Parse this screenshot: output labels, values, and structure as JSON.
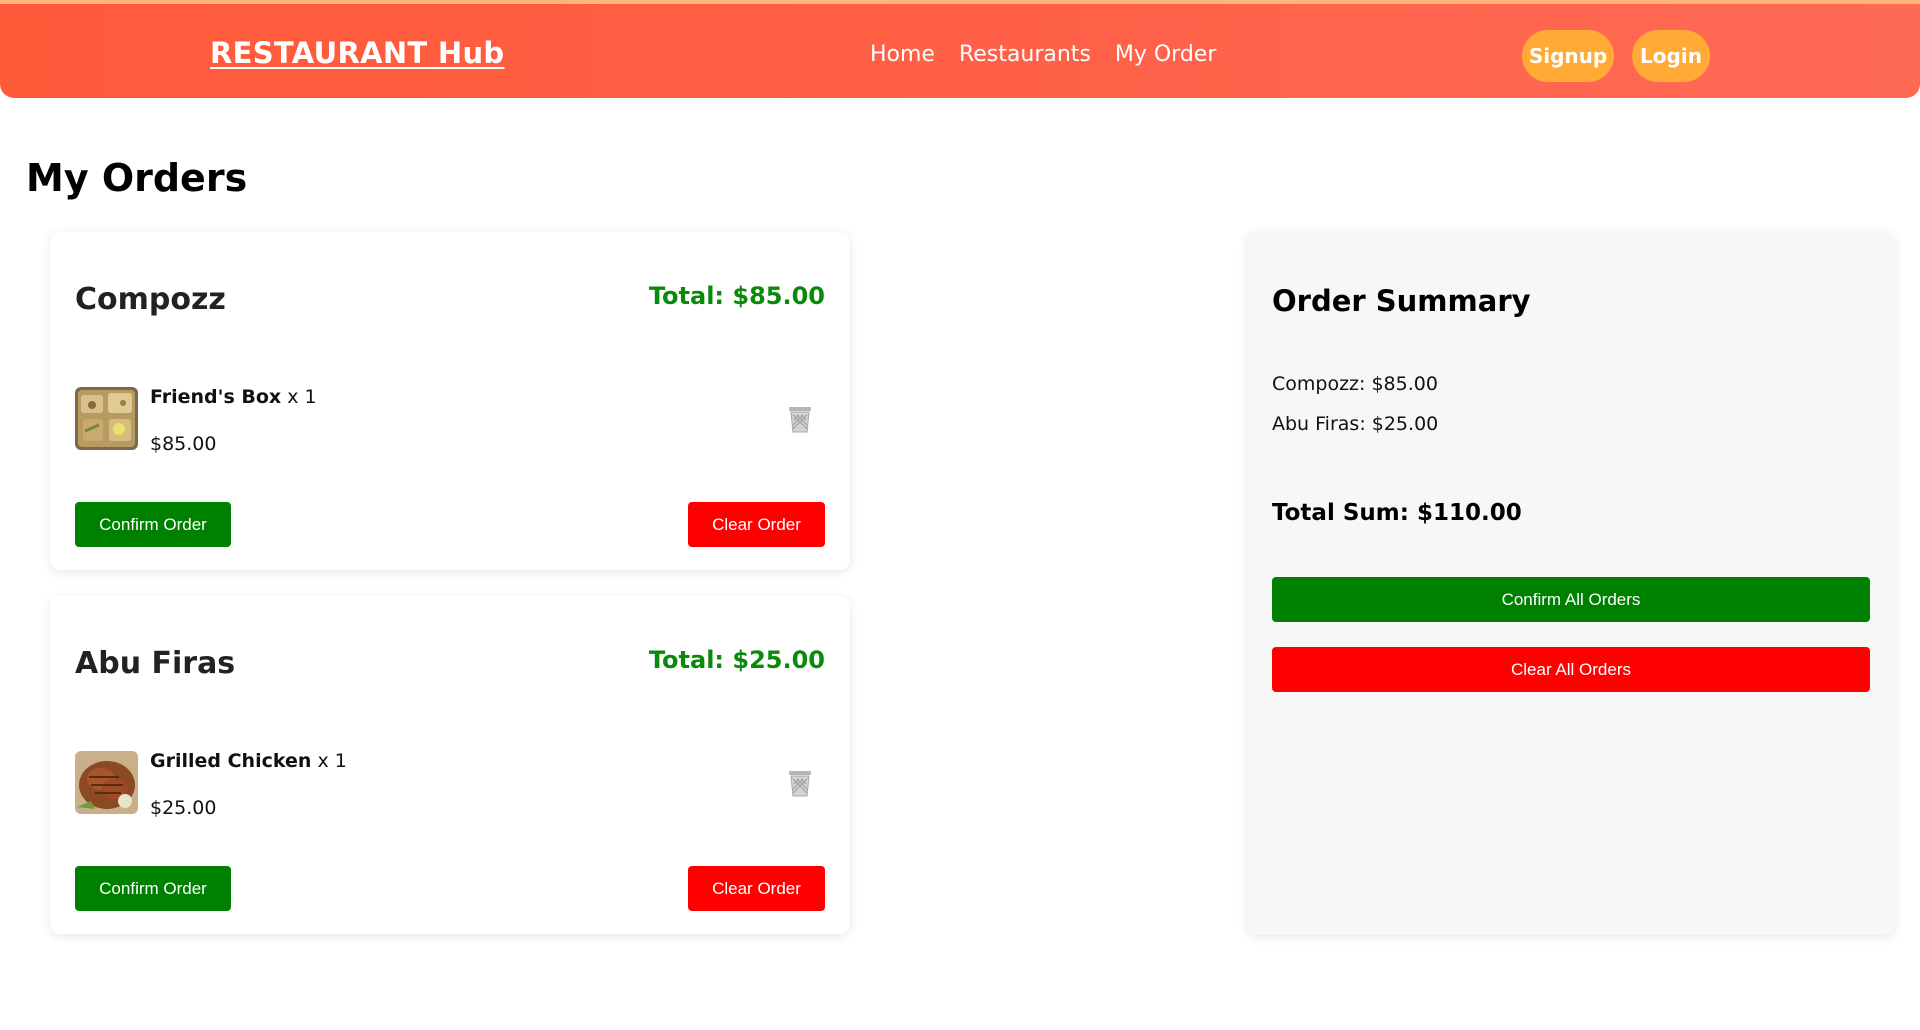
{
  "header": {
    "brand": "RESTAURANT Hub",
    "nav": [
      "Home",
      "Restaurants",
      "My Order"
    ],
    "signup_label": "Signup",
    "login_label": "Login"
  },
  "page_title": "My Orders",
  "orders": [
    {
      "restaurant": "Compozz",
      "total": "Total: $85.00",
      "item_name": "Friend's Box",
      "item_qty": "x 1",
      "item_price": "$85.00",
      "thumb_icon": "food-platter-image",
      "confirm_label": "Confirm Order",
      "clear_label": "Clear Order"
    },
    {
      "restaurant": "Abu Firas",
      "total": "Total: $25.00",
      "item_name": "Grilled Chicken",
      "item_qty": "x 1",
      "item_price": "$25.00",
      "thumb_icon": "grilled-chicken-image",
      "confirm_label": "Confirm Order",
      "clear_label": "Clear Order"
    }
  ],
  "summary": {
    "title": "Order Summary",
    "lines": [
      "Compozz: $85.00",
      "Abu Firas: $25.00"
    ],
    "total": "Total Sum: $110.00",
    "confirm_all_label": "Confirm All Orders",
    "clear_all_label": "Clear All Orders"
  },
  "colors": {
    "header_gradient_start": "#ff5a3a",
    "header_gradient_end": "#ff6a55",
    "pill": "#ffab35",
    "confirm_green": "#008000",
    "clear_red": "#ff0000",
    "total_green": "#0a8a0a"
  },
  "icons": {
    "trash": "trash-icon"
  }
}
